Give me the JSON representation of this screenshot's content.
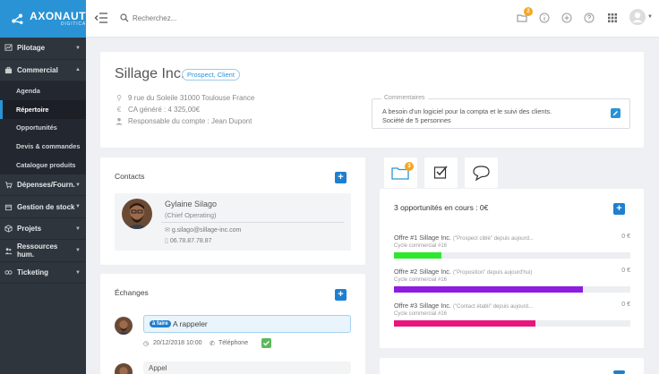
{
  "brand": {
    "name": "AXONAUT",
    "sub": "DIGITICA"
  },
  "sidebar": {
    "items": [
      {
        "label": "Pilotage",
        "icon": "chart-icon"
      },
      {
        "label": "Commercial",
        "icon": "briefcase-icon"
      },
      {
        "label": "Dépenses/Fourn.",
        "icon": "cart-icon"
      },
      {
        "label": "Gestion de stock",
        "icon": "box-icon"
      },
      {
        "label": "Projets",
        "icon": "cube-icon"
      },
      {
        "label": "Ressources hum.",
        "icon": "people-icon"
      },
      {
        "label": "Ticketing",
        "icon": "ticket-icon"
      }
    ],
    "sub": [
      "Agenda",
      "Répertoire",
      "Opportunités",
      "Devis & commandes",
      "Catalogue produits"
    ]
  },
  "topbar": {
    "search_placeholder": "Recherchez...",
    "badge_count": "2"
  },
  "company": {
    "name": "Sillage Inc.",
    "tag": "Prospect, Client",
    "address": "9 rue du Soleile 31000 Toulouse France",
    "revenue": "CA généré : 4 325,00€",
    "manager": "Responsable du compte : Jean Dupont",
    "comments_label": "Commentaires",
    "comments": [
      "A besoin d'un logiciel pour la compta et le suivi des clients.",
      "Société de 5 personnes"
    ]
  },
  "contacts": {
    "title": "Contacts",
    "name": "Gylaine Silago",
    "role": "(Chief Operating)",
    "email": "g.silago@sillage-inc.com",
    "phone": "06.78.87.78.87"
  },
  "exchanges": {
    "title": "Échanges",
    "tag": "à faire",
    "item_title": "A rappeler",
    "date": "20/12/2018 10:00",
    "type": "Téléphone",
    "item2_title": "Appel"
  },
  "tabs": {
    "badge": "3"
  },
  "opportunities": {
    "header": "3 opportunités en cours : 0€",
    "items": [
      {
        "title": "Offre #1 Sillage Inc.",
        "phase": "(\"Prospect ciblé\" depuis aujourd...",
        "amount": "0 €",
        "cycle": "Cycle commercial #16",
        "progress": 0.2,
        "color": "#2ee82e"
      },
      {
        "title": "Offre #2 Sillage Inc.",
        "phase": "(\"Proposition\" depuis aujourd'hui)",
        "amount": "0 €",
        "cycle": "Cycle commercial #16",
        "progress": 0.8,
        "color": "#8e1be0"
      },
      {
        "title": "Offre #3 Sillage Inc.",
        "phase": "(\"Contact établi\" depuis aujourd...",
        "amount": "0 €",
        "cycle": "Cycle commercial #16",
        "progress": 0.6,
        "color": "#e8157d"
      }
    ]
  }
}
